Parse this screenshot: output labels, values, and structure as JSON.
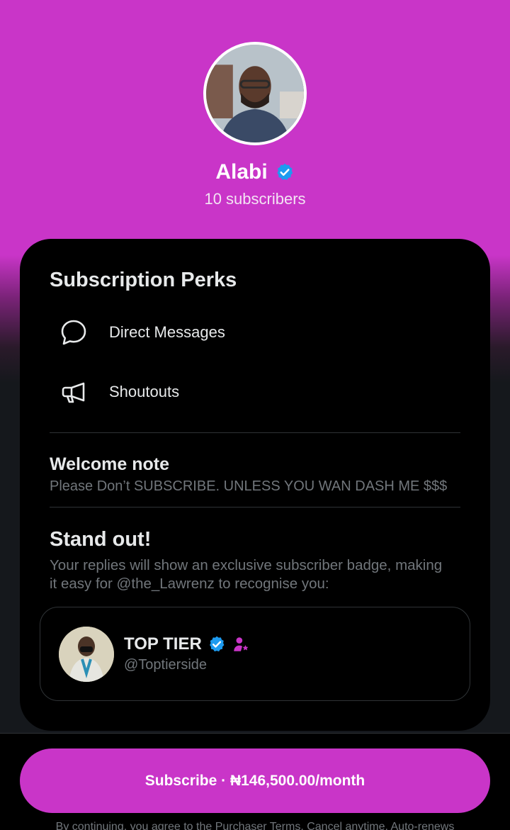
{
  "profile": {
    "name": "Alabi",
    "subscribers": "10 subscribers",
    "verified": true
  },
  "perks": {
    "title": "Subscription Perks",
    "items": [
      {
        "icon": "message-bubble-icon",
        "label": "Direct Messages"
      },
      {
        "icon": "megaphone-icon",
        "label": "Shoutouts"
      }
    ]
  },
  "welcome": {
    "title": "Welcome note",
    "text": "Please Don’t SUBSCRIBE. UNLESS YOU WAN DASH ME $$$"
  },
  "standout": {
    "title": "Stand out!",
    "description": "Your replies will show an exclusive subscriber badge, making it easy for @the_Lawrenz to recognise you:"
  },
  "badge_preview": {
    "name": "TOP TIER",
    "handle": "@Toptierside",
    "verified": true,
    "subscriber_badge_icon": "subscriber-badge-icon"
  },
  "footer": {
    "subscribe_label": "Subscribe · ₦146,500.00/month",
    "legal": "By continuing, you agree to the Purchaser Terms. Cancel anytime. Auto-renews"
  },
  "colors": {
    "accent": "#c935c8",
    "verified": "#1d9bf0",
    "background": "#15181c",
    "card": "#000000"
  }
}
